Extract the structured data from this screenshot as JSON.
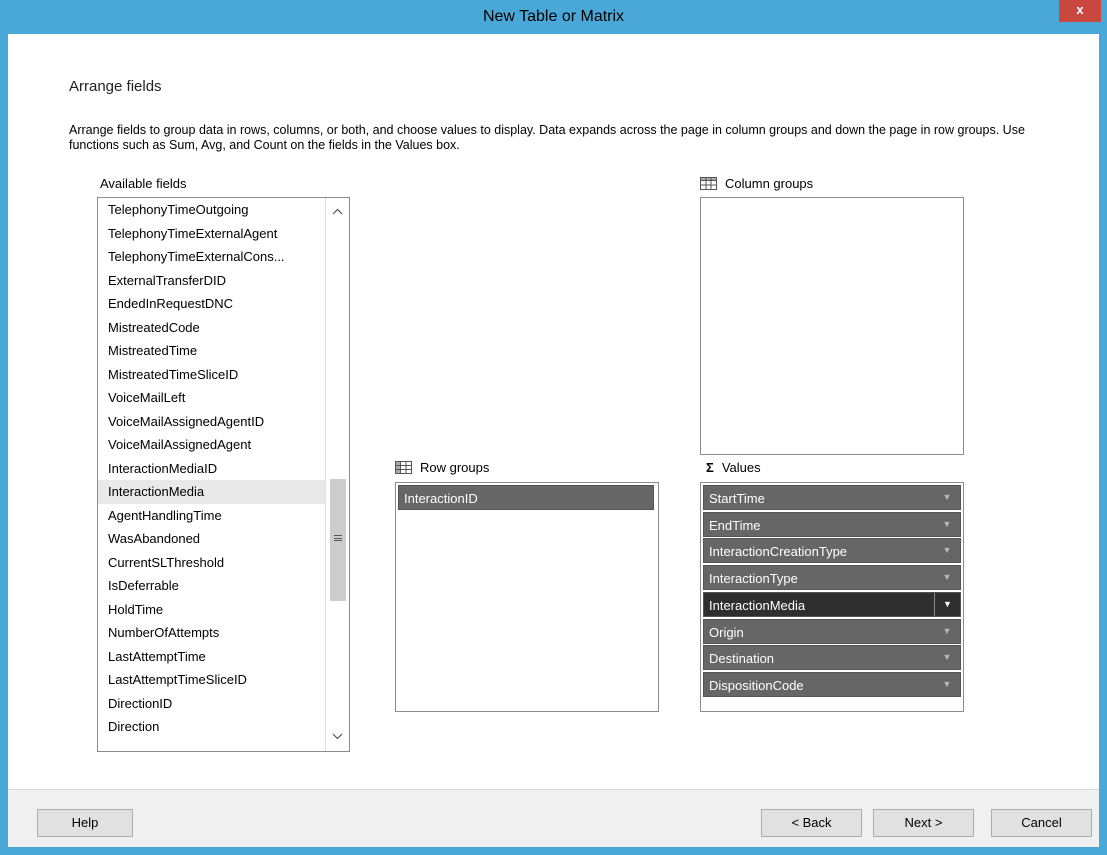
{
  "window": {
    "title": "New Table or Matrix",
    "close_label": "x"
  },
  "page": {
    "heading": "Arrange fields",
    "description": "Arrange fields to group data in rows, columns, or both, and choose values to display. Data expands across the page in column groups and down the page in row groups.  Use functions such as Sum, Avg, and Count on the fields in the Values box."
  },
  "available_fields": {
    "label": "Available fields",
    "items": [
      "TelephonyTimeOutgoing",
      "TelephonyTimeExternalAgent",
      "TelephonyTimeExternalCons...",
      "ExternalTransferDID",
      "EndedInRequestDNC",
      "MistreatedCode",
      "MistreatedTime",
      "MistreatedTimeSliceID",
      "VoiceMailLeft",
      "VoiceMailAssignedAgentID",
      "VoiceMailAssignedAgent",
      "InteractionMediaID",
      "InteractionMedia",
      "AgentHandlingTime",
      "WasAbandoned",
      "CurrentSLThreshold",
      "IsDeferrable",
      "HoldTime",
      "NumberOfAttempts",
      "LastAttemptTime",
      "LastAttemptTimeSliceID",
      "DirectionID",
      "Direction"
    ],
    "selected": "InteractionMedia"
  },
  "column_groups": {
    "label": "Column groups",
    "items": []
  },
  "row_groups": {
    "label": "Row groups",
    "items": [
      "InteractionID"
    ]
  },
  "values": {
    "label": "Values",
    "icon_glyph": "Σ",
    "items": [
      "StartTime",
      "EndTime",
      "InteractionCreationType",
      "InteractionType",
      "InteractionMedia",
      "Origin",
      "Destination",
      "DispositionCode"
    ],
    "active": "InteractionMedia"
  },
  "buttons": {
    "help": "Help",
    "back": "< Back",
    "next": "Next >",
    "cancel": "Cancel"
  },
  "colors": {
    "title_bar": "#4aa8d8",
    "close": "#c9473e",
    "chip": "#666666",
    "chip_active": "#2f2f2f"
  }
}
